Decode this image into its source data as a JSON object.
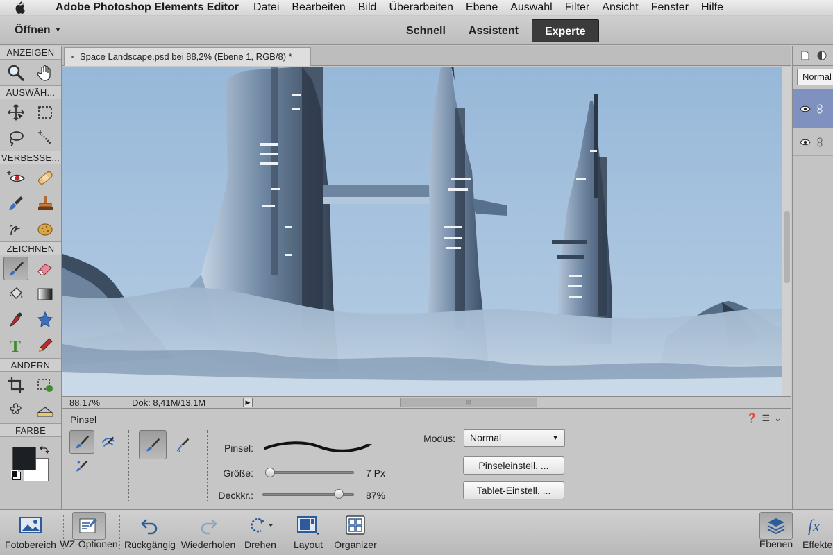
{
  "app": {
    "name": "Adobe Photoshop Elements Editor",
    "menu": [
      "Datei",
      "Bearbeiten",
      "Bild",
      "Überarbeiten",
      "Ebene",
      "Auswahl",
      "Filter",
      "Ansicht",
      "Fenster",
      "Hilfe"
    ]
  },
  "modebar": {
    "open_label": "Öffnen",
    "modes": [
      "Schnell",
      "Assistent",
      "Experte"
    ],
    "active_mode": "Experte"
  },
  "toolbox": {
    "sections": [
      "ANZEIGEN",
      "AUSWÄH...",
      "VERBESSE...",
      "ZEICHNEN",
      "ÄNDERN",
      "FARBE"
    ],
    "foreground_color": "#1c1f24",
    "background_color": "#ffffff"
  },
  "document": {
    "tab_title": "Space Landscape.psd bei 88,2% (Ebene 1, RGB/8) *",
    "zoom": "88,17%",
    "doc_size": "Dok: 8,41M/13,1M"
  },
  "layers_panel": {
    "blend_mode": "Normal"
  },
  "options": {
    "tool_name": "Pinsel",
    "brush_label": "Pinsel:",
    "size_label": "Größe:",
    "size_value": "7 Px",
    "size_fraction": 0.0,
    "opacity_label": "Deckkr.:",
    "opacity_value": "87%",
    "opacity_fraction": 0.87,
    "mode_label": "Modus:",
    "mode_value": "Normal",
    "brush_settings_button": "Pinseleinstell. ...",
    "tablet_settings_button": "Tablet-Einstell. ..."
  },
  "bottombar": {
    "items": [
      "Fotobereich",
      "WZ-Optionen",
      "Rückgängig",
      "Wiederholen",
      "Drehen",
      "Layout",
      "Organizer",
      "Ebenen",
      "Effekte"
    ]
  },
  "colors": {
    "accent_active_mode": "#3b3b3b",
    "selected_layer": "#7f91be",
    "sky": "#a9c4df"
  }
}
